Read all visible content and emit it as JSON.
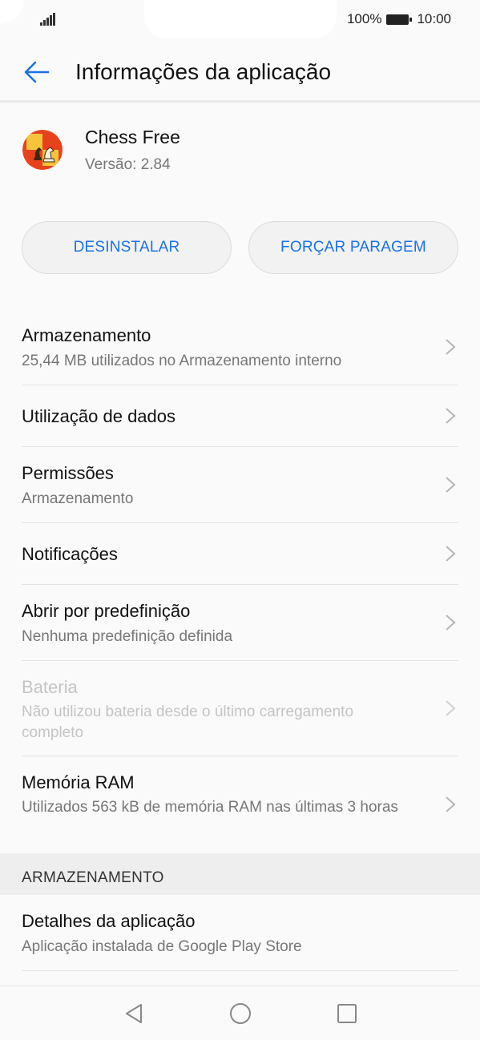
{
  "status_bar": {
    "battery_percent": "100%",
    "time": "10:00"
  },
  "header": {
    "title": "Informações da aplicação",
    "accent_color": "#1a73e8"
  },
  "app": {
    "name": "Chess Free",
    "version": "Versão: 2.84"
  },
  "buttons": {
    "uninstall": "DESINSTALAR",
    "force_stop": "FORÇAR PARAGEM"
  },
  "list": [
    {
      "title": "Armazenamento",
      "subtitle": "25,44 MB utilizados no Armazenamento interno",
      "enabled": true
    },
    {
      "title": "Utilização de dados",
      "subtitle": "",
      "enabled": true
    },
    {
      "title": "Permissões",
      "subtitle": "Armazenamento",
      "enabled": true
    },
    {
      "title": "Notificações",
      "subtitle": "",
      "enabled": true
    },
    {
      "title": "Abrir por predefinição",
      "subtitle": "Nenhuma predefinição definida",
      "enabled": true
    },
    {
      "title": "Bateria",
      "subtitle": "Não utilizou bateria desde o último carregamento completo",
      "enabled": false
    },
    {
      "title": "Memória RAM",
      "subtitle": "Utilizados 563 kB de memória RAM nas últimas 3 horas",
      "enabled": true
    }
  ],
  "section_header": "ARMAZENAMENTO",
  "details": {
    "title": "Detalhes da aplicação",
    "subtitle": "Aplicação instalada de Google Play Store"
  },
  "icons": [
    "signal-icon",
    "battery-icon",
    "back-arrow-icon",
    "chess-app-icon",
    "chevron-right-icon",
    "nav-back-icon",
    "nav-home-icon",
    "nav-recents-icon"
  ]
}
